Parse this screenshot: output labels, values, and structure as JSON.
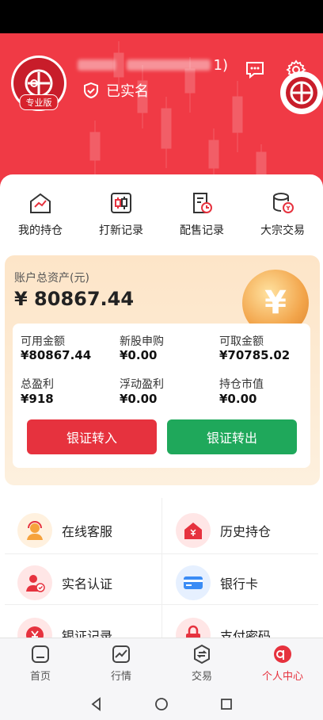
{
  "header": {
    "username_suffix": "1)",
    "verified_label": "已实名",
    "avatar_badge": "专业版",
    "colors": {
      "primary": "#f03a45",
      "green": "#1fa85b"
    }
  },
  "quick_actions": [
    {
      "label": "我的持仓",
      "icon": "chart-house-icon"
    },
    {
      "label": "打新记录",
      "icon": "candlestick-icon"
    },
    {
      "label": "配售记录",
      "icon": "document-clock-icon"
    },
    {
      "label": "大宗交易",
      "icon": "database-yen-icon"
    }
  ],
  "asset": {
    "label": "账户总资产(元)",
    "value": "¥ 80867.44",
    "stats": [
      {
        "label": "可用金额",
        "value": "¥80867.44"
      },
      {
        "label": "新股申购",
        "value": "¥0.00"
      },
      {
        "label": "可取金额",
        "value": "¥70785.02"
      },
      {
        "label": "总盈利",
        "value": "¥918"
      },
      {
        "label": "浮动盈利",
        "value": "¥0.00"
      },
      {
        "label": "持仓市值",
        "value": "¥0.00"
      }
    ],
    "transfer_in": "银证转入",
    "transfer_out": "银证转出"
  },
  "menu": [
    {
      "label": "在线客服",
      "icon": "customer-service-icon"
    },
    {
      "label": "历史持仓",
      "icon": "history-house-icon"
    },
    {
      "label": "实名认证",
      "icon": "user-verify-icon"
    },
    {
      "label": "银行卡",
      "icon": "bank-card-icon"
    },
    {
      "label": "银证记录",
      "icon": "yen-record-icon"
    },
    {
      "label": "支付密码",
      "icon": "lock-icon"
    }
  ],
  "tabs": [
    {
      "label": "首页",
      "icon": "home-icon"
    },
    {
      "label": "行情",
      "icon": "market-icon"
    },
    {
      "label": "交易",
      "icon": "trade-icon"
    },
    {
      "label": "个人中心",
      "icon": "profile-icon",
      "active": true
    }
  ]
}
